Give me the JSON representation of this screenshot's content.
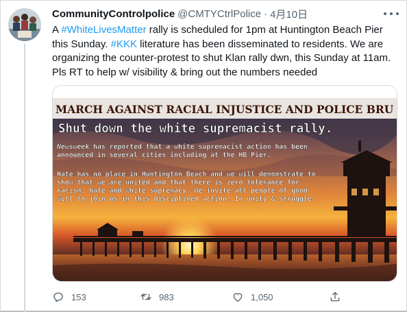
{
  "tweet": {
    "display_name": "CommunityControlpolice",
    "handle": "@CMTYCtrlPolice",
    "separator": "·",
    "date": "4月10日",
    "text": {
      "part1": "A ",
      "hashtag1": "#WhiteLivesMatter",
      "part2": " rally is scheduled for 1pm at Huntington Beach Pier this Sunday. ",
      "hashtag2": "#KKK",
      "part3": " literature has been disseminated to residents. We are organizing the counter-protest to shut Klan rally dwn, this Sunday at 11am. Pls RT to help w/ visibility & bring out the numbers needed"
    }
  },
  "flyer": {
    "banner": "MARCH AGAINST RACIAL INJUSTICE AND POLICE BRU",
    "headline": "Shut down the white supremacist rally.",
    "para1_source": "Newsweek",
    "para1_line1": " has reported that a white supremacist action has been",
    "para1_line2": "announced in several cities including at the HB Pier.",
    "para2_lines": [
      "Hate has no place in Huntington Beach and we will demonstrate to",
      "show that we are united and that there is zero tolerance for",
      "racism, hate and white supremacy.  We invite all people of good",
      "will to join us in this disciplined action.  In unity & struggle."
    ]
  },
  "actions": {
    "reply_count": "153",
    "retweet_count": "983",
    "like_count": "1,050"
  },
  "icons": [
    "more-icon",
    "reply-icon",
    "retweet-icon",
    "like-icon",
    "share-icon"
  ],
  "colors": {
    "link": "#1d9bf0",
    "secondary_text": "#536471",
    "flyer_banner_text": "#3a1608"
  }
}
